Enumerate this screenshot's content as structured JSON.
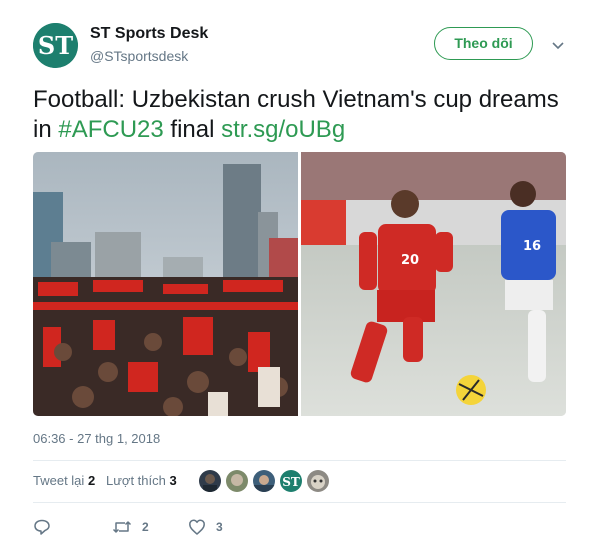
{
  "account": {
    "name": "ST Sports Desk",
    "handle": "@STsportsdesk",
    "avatar_monogram": "ST",
    "avatar_color": "#1d7f6e"
  },
  "follow_button": {
    "label": "Theo dõi"
  },
  "tweet": {
    "text_start": "Football: Uzbekistan crush Vietnam's cup dreams in ",
    "hashtag": "#AFCU23",
    "text_middle": " final ",
    "url": "str.sg/oUBg",
    "timestamp": "06:36 - 27 thg 1, 2018"
  },
  "media": {
    "left_image": "crowd-of-fans-with-red-flags-in-city",
    "right_image": "two-footballers-chasing-ball-on-snowy-pitch",
    "jersey_numbers": [
      "20",
      "16"
    ]
  },
  "stats": {
    "retweets_label": "Tweet lại",
    "retweets_count": "2",
    "likes_label": "Lượt thích",
    "likes_count": "3"
  },
  "liker_avatar_monogram": "ST",
  "actions": {
    "reply_icon": "reply-icon",
    "retweet_icon": "retweet-icon",
    "retweet_count": "2",
    "like_icon": "heart-icon",
    "like_count": "3"
  },
  "colors": {
    "accent": "#2e9a53",
    "muted": "#657786",
    "text": "#14171a"
  }
}
